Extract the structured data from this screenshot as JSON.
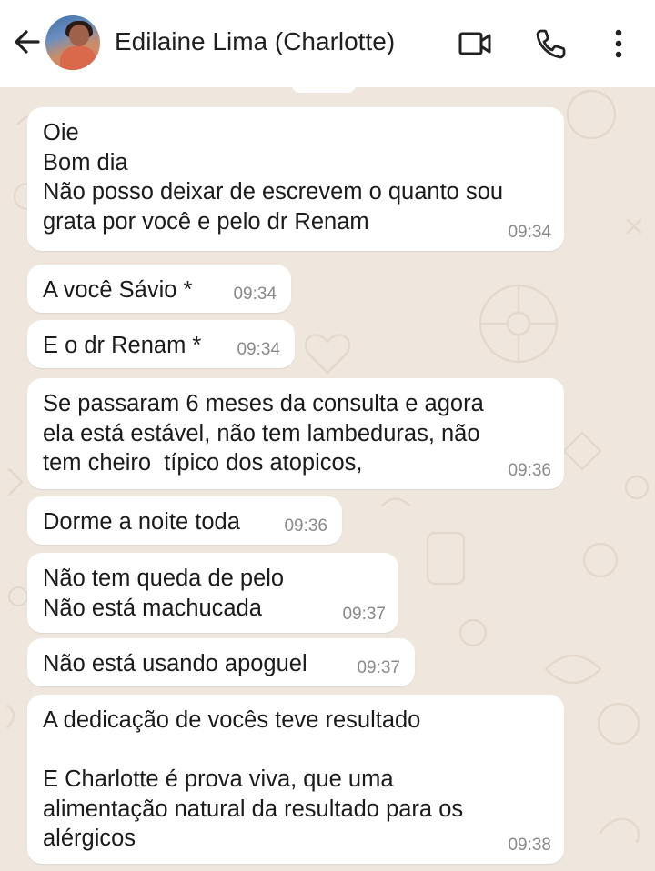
{
  "header": {
    "contact_name": "Edilaine Lima (Charlotte)",
    "back_icon": "arrow-left-icon",
    "video_icon": "video-camera-icon",
    "call_icon": "phone-icon",
    "menu_icon": "more-vertical-icon"
  },
  "colors": {
    "chat_background": "#efe7de",
    "bubble": "#ffffff",
    "timestamp": "#8a8a8a"
  },
  "messages": [
    {
      "text": "Oie\nBom dia\nNão posso deixar de escrevem o quanto sou\ngrata por você e pelo dr Renam",
      "time": "09:34"
    },
    {
      "text": "A você Sávio *",
      "time": "09:34"
    },
    {
      "text": "E o dr Renam *",
      "time": "09:34"
    },
    {
      "text": "Se passaram 6 meses da consulta e agora\nela está estável, não tem lambeduras, não\ntem cheiro  típico dos atopicos,",
      "time": "09:36"
    },
    {
      "text": "Dorme a noite toda",
      "time": "09:36"
    },
    {
      "text": "Não tem queda de pelo\nNão está machucada",
      "time": "09:37"
    },
    {
      "text": "Não está usando apoguel",
      "time": "09:37"
    },
    {
      "text": "A dedicação de vocês teve resultado\n\nE Charlotte é prova viva, que uma\nalimentação natural da resultado para os\nalérgicos",
      "time": "09:38"
    }
  ]
}
